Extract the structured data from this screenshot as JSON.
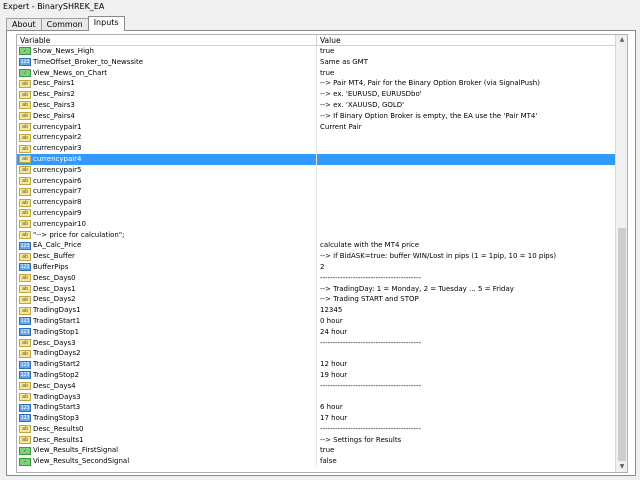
{
  "window": {
    "title": "Expert - BinarySHREK_EA"
  },
  "tabs": [
    {
      "label": "About",
      "active": false
    },
    {
      "label": "Common",
      "active": false
    },
    {
      "label": "Inputs",
      "active": true
    }
  ],
  "table": {
    "columns": {
      "variable": "Variable",
      "value": "Value"
    },
    "selected_index": 10,
    "rows": [
      {
        "type": "bool",
        "name": "Show_News_High",
        "value": "true"
      },
      {
        "type": "int",
        "name": "TimeOffset_Broker_to_Newssite",
        "value": "Same as GMT"
      },
      {
        "type": "bool",
        "name": "View_News_on_Chart",
        "value": "true"
      },
      {
        "type": "str",
        "name": "Desc_Pairs1",
        "value": "--> Pair MT4, Pair for the Binary Option Broker (via SignalPush)"
      },
      {
        "type": "str",
        "name": "Desc_Pairs2",
        "value": "--> ex. 'EURUSD, EURUSDbo'"
      },
      {
        "type": "str",
        "name": "Desc_Pairs3",
        "value": "--> ex. 'XAUUSD, GOLD'"
      },
      {
        "type": "str",
        "name": "Desc_Pairs4",
        "value": "--> If Binary Option Broker is empty, the EA use the 'Pair MT4'"
      },
      {
        "type": "str",
        "name": "currencypair1",
        "value": "Current Pair"
      },
      {
        "type": "str",
        "name": "currencypair2",
        "value": ""
      },
      {
        "type": "str",
        "name": "currencypair3",
        "value": ""
      },
      {
        "type": "str",
        "name": "currencypair4",
        "value": ""
      },
      {
        "type": "str",
        "name": "currencypair5",
        "value": ""
      },
      {
        "type": "str",
        "name": "currencypair6",
        "value": ""
      },
      {
        "type": "str",
        "name": "currencypair7",
        "value": ""
      },
      {
        "type": "str",
        "name": "currencypair8",
        "value": ""
      },
      {
        "type": "str",
        "name": "currencypair9",
        "value": ""
      },
      {
        "type": "str",
        "name": "currencypair10",
        "value": ""
      },
      {
        "type": "str",
        "name": "\"--> price for calculation\";",
        "value": ""
      },
      {
        "type": "int",
        "name": "EA_Calc_Price",
        "value": "calculate with the MT4 price"
      },
      {
        "type": "str",
        "name": "Desc_Buffer",
        "value": "--> if BidASK=true: buffer WIN/Lost in pips (1 = 1pip, 10 = 10 pips)"
      },
      {
        "type": "int",
        "name": "BufferPips",
        "value": "2"
      },
      {
        "type": "str",
        "name": "Desc_Days0",
        "value": "----------------------------------------"
      },
      {
        "type": "str",
        "name": "Desc_Days1",
        "value": "--> TradingDay: 1 = Monday, 2 = Tuesday ... 5 = Friday"
      },
      {
        "type": "str",
        "name": "Desc_Days2",
        "value": "--> Trading START and STOP"
      },
      {
        "type": "str",
        "name": "TradingDays1",
        "value": "12345"
      },
      {
        "type": "int",
        "name": "TradingStart1",
        "value": "0 hour"
      },
      {
        "type": "int",
        "name": "TradingStop1",
        "value": "24 hour"
      },
      {
        "type": "str",
        "name": "Desc_Days3",
        "value": "----------------------------------------"
      },
      {
        "type": "str",
        "name": "TradingDays2",
        "value": ""
      },
      {
        "type": "int",
        "name": "TradingStart2",
        "value": "12 hour"
      },
      {
        "type": "int",
        "name": "TradingStop2",
        "value": "19 hour"
      },
      {
        "type": "str",
        "name": "Desc_Days4",
        "value": "----------------------------------------"
      },
      {
        "type": "str",
        "name": "TradingDays3",
        "value": ""
      },
      {
        "type": "int",
        "name": "TradingStart3",
        "value": "6 hour"
      },
      {
        "type": "int",
        "name": "TradingStop3",
        "value": "17 hour"
      },
      {
        "type": "str",
        "name": "Desc_Results0",
        "value": "----------------------------------------"
      },
      {
        "type": "str",
        "name": "Desc_Results1",
        "value": "--> Settings for Results"
      },
      {
        "type": "bool",
        "name": "View_Results_FirstSignal",
        "value": "true"
      },
      {
        "type": "bool",
        "name": "View_Results_SecondSignal",
        "value": "false"
      }
    ]
  },
  "icons": {
    "bool": "bool-icon",
    "int": "integer-icon",
    "str": "string-icon"
  },
  "colors": {
    "selection": "#3399ff"
  }
}
